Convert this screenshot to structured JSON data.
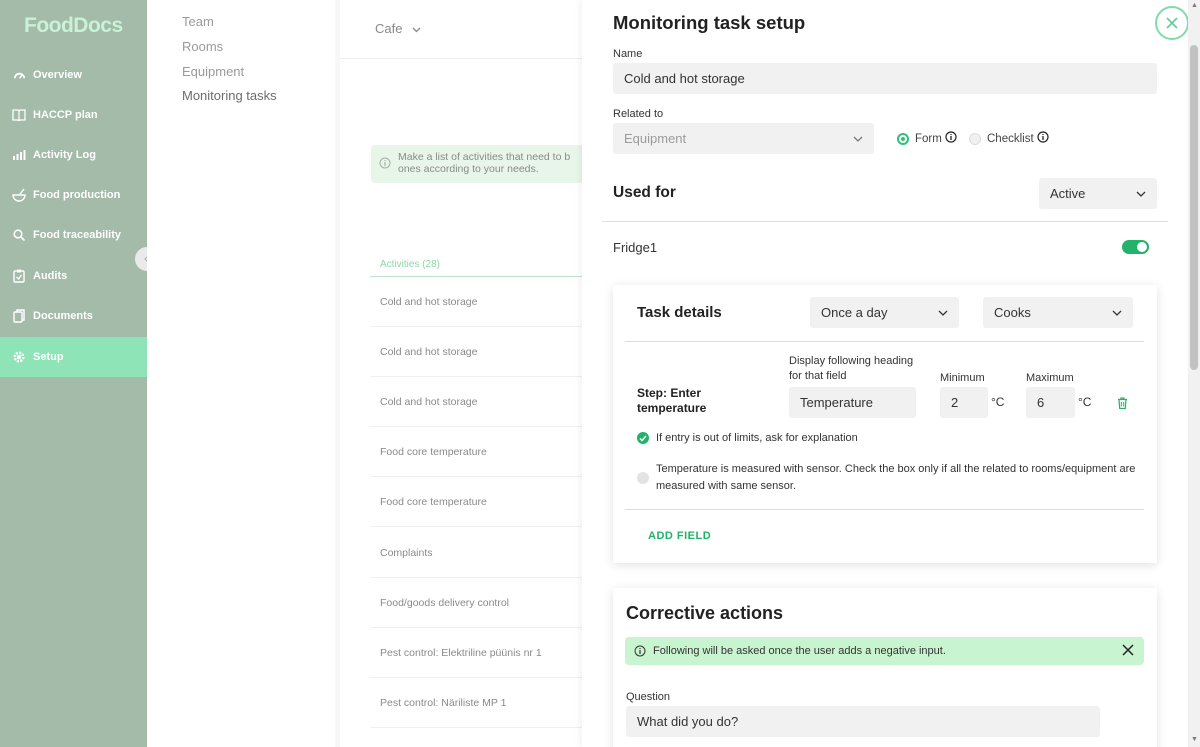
{
  "app": {
    "logo": "FoodDocs"
  },
  "sidebar": {
    "items": [
      {
        "label": "Overview",
        "icon": "gauge-icon"
      },
      {
        "label": "HACCP plan",
        "icon": "book-icon"
      },
      {
        "label": "Activity Log",
        "icon": "bar-chart-icon"
      },
      {
        "label": "Food production",
        "icon": "bowl-icon"
      },
      {
        "label": "Food traceability",
        "icon": "search-icon"
      },
      {
        "label": "Audits",
        "icon": "clipboard-icon"
      },
      {
        "label": "Documents",
        "icon": "documents-icon"
      },
      {
        "label": "Setup",
        "icon": "gear-icon"
      }
    ],
    "active": "Setup",
    "accent": "#8fe4b7"
  },
  "subnav": {
    "items": [
      "Team",
      "Rooms",
      "Equipment",
      "Monitoring tasks"
    ],
    "active": "Monitoring tasks"
  },
  "middle": {
    "location": "Cafe",
    "info": "Make a list of activities that need to b ones according to your needs.",
    "activities_header": "Activities (28)",
    "activities": [
      "Cold and hot storage",
      "Cold and hot storage",
      "Cold and hot storage",
      "Food core temperature",
      "Food core temperature",
      "Complaints",
      "Food/goods delivery control",
      "Pest control: Elektriline püünis nr 1",
      "Pest control: Näriliste MP 1"
    ]
  },
  "panel": {
    "title": "Monitoring task setup",
    "name_label": "Name",
    "name_value": "Cold and hot storage",
    "related_label": "Related to",
    "related_value": "Equipment",
    "radio_form": "Form",
    "radio_checklist": "Checklist",
    "radio_selected": "Form",
    "used_for_title": "Used for",
    "used_for_status": "Active",
    "item_label": "Fridge1",
    "item_enabled": true,
    "task": {
      "title": "Task details",
      "frequency": "Once a day",
      "role": "Cooks",
      "step_label": "Step: Enter temperature",
      "heading_label": "Display following heading for that field",
      "heading_value": "Temperature",
      "min_label": "Minimum",
      "min_value": "2",
      "max_label": "Maximum",
      "max_value": "6",
      "unit": "°C",
      "check1": "If entry is out of limits, ask for explanation",
      "check1_checked": true,
      "check2": "Temperature is measured with sensor. Check the box only if all the related to rooms/equipment are measured with same sensor.",
      "check2_checked": false,
      "add_field": "ADD FIELD"
    },
    "corrective": {
      "title": "Corrective actions",
      "alert": "Following will be asked once the user adds a negative input.",
      "question_label": "Question",
      "question_value": "What did you do?"
    }
  }
}
